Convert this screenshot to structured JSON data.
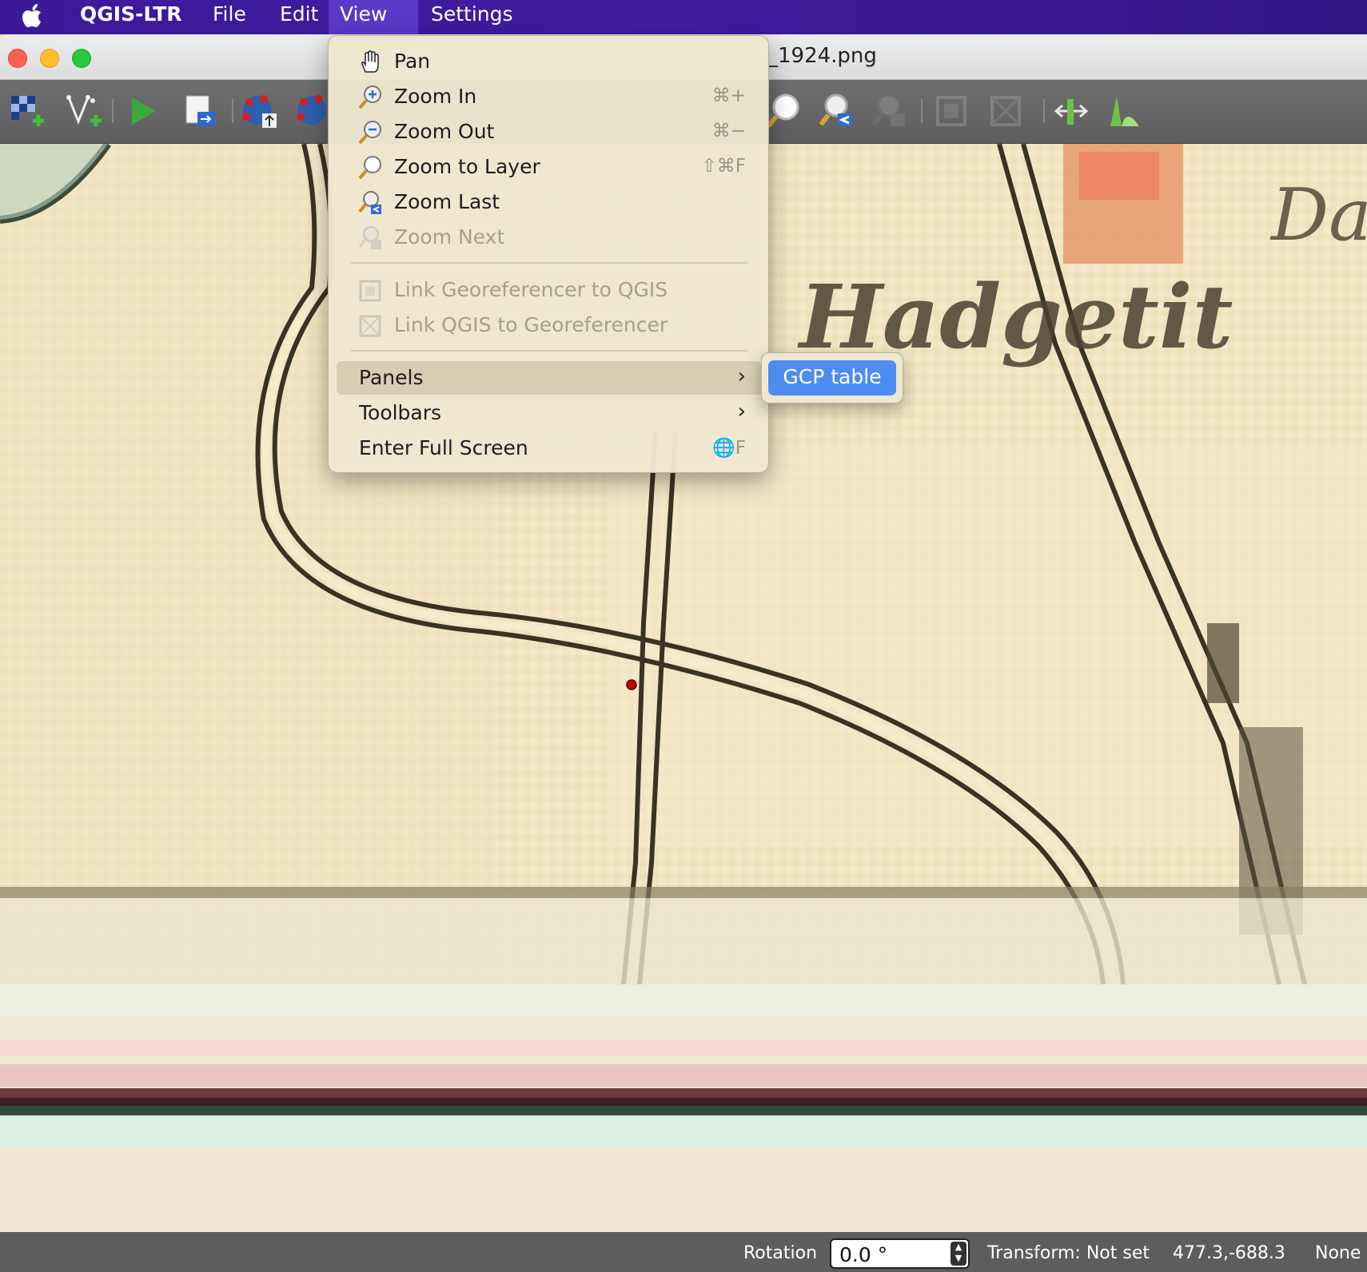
{
  "menubar": {
    "app": "QGIS-LTR",
    "items": [
      "File",
      "Edit",
      "View",
      "Settings"
    ]
  },
  "window": {
    "title": "_1924.png"
  },
  "view_menu": {
    "items": [
      {
        "label": "Pan",
        "icon": "pan-hand-icon",
        "shortcut": "",
        "enabled": true
      },
      {
        "label": "Zoom In",
        "icon": "zoom-in-icon",
        "shortcut": "⌘+",
        "enabled": true
      },
      {
        "label": "Zoom Out",
        "icon": "zoom-out-icon",
        "shortcut": "⌘−",
        "enabled": true
      },
      {
        "label": "Zoom to Layer",
        "icon": "zoom-to-layer-icon",
        "shortcut": "⇧⌘F",
        "enabled": true
      },
      {
        "label": "Zoom Last",
        "icon": "zoom-last-icon",
        "shortcut": "",
        "enabled": true
      },
      {
        "label": "Zoom Next",
        "icon": "zoom-next-icon",
        "shortcut": "",
        "enabled": false
      },
      {
        "label": "Link Georeferencer to QGIS",
        "icon": "link-georef-icon",
        "shortcut": "",
        "enabled": false
      },
      {
        "label": "Link QGIS to Georeferencer",
        "icon": "link-qgis-icon",
        "shortcut": "",
        "enabled": false
      },
      {
        "label": "Panels",
        "shortcut": "",
        "enabled": true,
        "submenu": true
      },
      {
        "label": "Toolbars",
        "shortcut": "",
        "enabled": true,
        "submenu": true
      },
      {
        "label": "Enter Full Screen",
        "shortcut": "🌐F",
        "enabled": true
      }
    ]
  },
  "panels_submenu": {
    "items": [
      "GCP table"
    ]
  },
  "status": {
    "rotation_label": "Rotation",
    "rotation_value": "0.0 °",
    "transform": "Transform: Not set",
    "coords": "477.3,-688.3",
    "crs": "None"
  },
  "colors": {
    "menubar": "#3f1c9e",
    "highlight": "#4e8df0",
    "map_paper": "#efe3c4",
    "gcp_point": "#d00000"
  }
}
